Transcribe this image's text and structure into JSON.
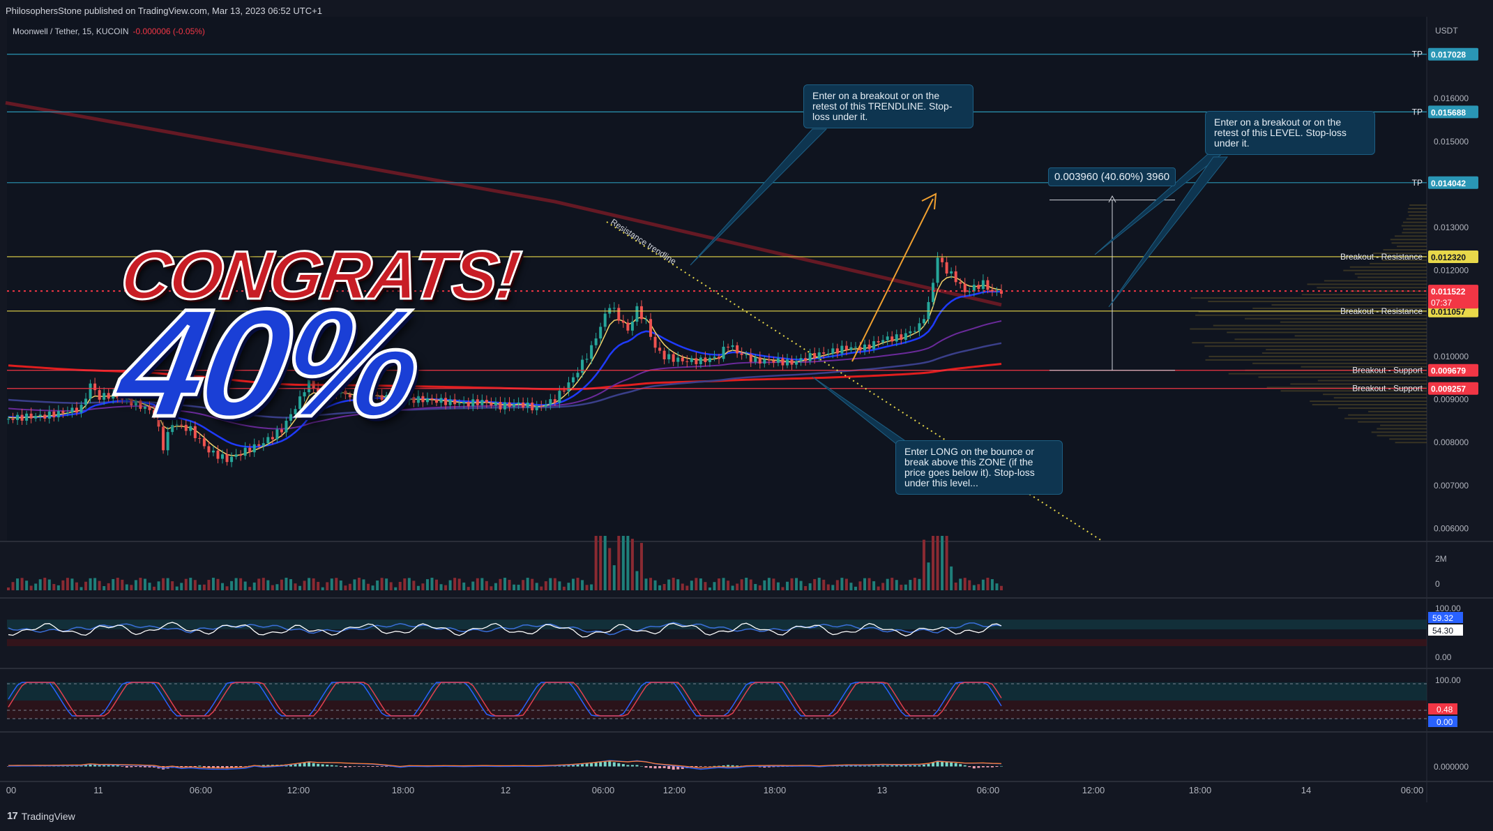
{
  "publish_line": "PhilosophersStone published on TradingView.com, Mar 13, 2023 06:52 UTC+1",
  "legend": {
    "symbol": "Moonwell / Tether, 15, KUCOIN",
    "change": "-0.000006 (-0.05%)"
  },
  "brand": "TradingView",
  "overlay": {
    "congrats": "CONGRATS!",
    "percent": "40%"
  },
  "measure_label": "0.003960 (40.60%) 3960",
  "callouts": {
    "trendline": "Enter on a breakout or on the retest of this TRENDLINE. Stop-loss under it.",
    "level": "Enter on a breakout or on the retest of this LEVEL. Stop-loss under it.",
    "zone": "Enter LONG on the bounce or break above this ZONE (if the price goes below it). Stop-loss under this level..."
  },
  "trendline_label": "Resistance trendline",
  "colors": {
    "bg": "#131722",
    "up": "#26a69a",
    "down": "#ef5350",
    "tp": "#2a96b5",
    "resistance": "#e8d84a",
    "support": "#f23645"
  },
  "chart_data": {
    "type": "candlestick",
    "quote_currency": "USDT",
    "price_axis": {
      "min": 0.0057,
      "max": 0.0179,
      "ticks": [
        "0.016000",
        "0.015000",
        "0.013000",
        "0.012000",
        "0.010000",
        "0.009000",
        "0.008000",
        "0.007000",
        "0.006000"
      ]
    },
    "time_axis": {
      "ticks": [
        "00",
        "11",
        "06:00",
        "12:00",
        "18:00",
        "12",
        "06:00",
        "12:00",
        "18:00",
        "13",
        "06:00",
        "12:00",
        "18:00",
        "14",
        "06:00"
      ]
    },
    "current_price": {
      "value": "0.011522",
      "countdown": "07:37"
    },
    "levels": [
      {
        "name": "TP",
        "value": "0.017028",
        "kind": "tp"
      },
      {
        "name": "TP",
        "value": "0.015688",
        "kind": "tp"
      },
      {
        "name": "TP",
        "value": "0.014042",
        "kind": "tp"
      },
      {
        "name": "Breakout - Resistance",
        "value": "0.012320",
        "kind": "resistance"
      },
      {
        "name": "Breakout - Resistance",
        "value": "0.011057",
        "kind": "resistance"
      },
      {
        "name": "Breakout - Support",
        "value": "0.009679",
        "kind": "support"
      },
      {
        "name": "Breakout - Support",
        "value": "0.009257",
        "kind": "support"
      }
    ],
    "price_path": [
      [
        0,
        0.00855
      ],
      [
        2,
        0.0086
      ],
      [
        4,
        0.00862
      ],
      [
        6,
        0.0087
      ],
      [
        8,
        0.0088
      ],
      [
        9,
        0.00935
      ],
      [
        10,
        0.00905
      ],
      [
        11,
        0.0091
      ],
      [
        12,
        0.00905
      ],
      [
        14,
        0.0089
      ],
      [
        16,
        0.0087
      ],
      [
        17,
        0.0079
      ],
      [
        18,
        0.00845
      ],
      [
        20,
        0.0083
      ],
      [
        22,
        0.0078
      ],
      [
        24,
        0.0076
      ],
      [
        26,
        0.0078
      ],
      [
        28,
        0.008
      ],
      [
        30,
        0.0083
      ],
      [
        32,
        0.009
      ],
      [
        33,
        0.0095
      ],
      [
        34,
        0.0091
      ],
      [
        36,
        0.0092
      ],
      [
        38,
        0.00905
      ],
      [
        40,
        0.0091
      ],
      [
        42,
        0.009
      ],
      [
        44,
        0.009
      ],
      [
        46,
        0.009
      ],
      [
        48,
        0.00895
      ],
      [
        50,
        0.0089
      ],
      [
        52,
        0.00895
      ],
      [
        54,
        0.00885
      ],
      [
        56,
        0.0089
      ],
      [
        58,
        0.0088
      ],
      [
        60,
        0.009
      ],
      [
        62,
        0.0095
      ],
      [
        64,
        0.0102
      ],
      [
        66,
        0.0112
      ],
      [
        67,
        0.0109
      ],
      [
        68,
        0.0106
      ],
      [
        69,
        0.0111
      ],
      [
        70,
        0.0108
      ],
      [
        71,
        0.0102
      ],
      [
        72,
        0.01
      ],
      [
        74,
        0.0099
      ],
      [
        76,
        0.0099
      ],
      [
        78,
        0.01
      ],
      [
        79,
        0.0103
      ],
      [
        80,
        0.0101
      ],
      [
        82,
        0.0099
      ],
      [
        84,
        0.0099
      ],
      [
        86,
        0.00985
      ],
      [
        88,
        0.01
      ],
      [
        90,
        0.0101
      ],
      [
        92,
        0.0102
      ],
      [
        94,
        0.0102
      ],
      [
        96,
        0.0104
      ],
      [
        98,
        0.01045
      ],
      [
        100,
        0.0107
      ],
      [
        101,
        0.0112
      ],
      [
        102,
        0.0123
      ],
      [
        103,
        0.012
      ],
      [
        104,
        0.0118
      ],
      [
        105,
        0.0115
      ],
      [
        106,
        0.0116
      ],
      [
        107,
        0.0117
      ],
      [
        108,
        0.0115
      ],
      [
        109,
        0.01152
      ]
    ],
    "measure": {
      "from": 0.009679,
      "to": 0.013639,
      "label": "0.003960 (40.60%) 3960"
    }
  },
  "panes": {
    "volume_ticks": [
      "2M",
      "0"
    ],
    "rsi": {
      "ticks": [
        "100.00",
        "0.00"
      ],
      "value_a": "59.32",
      "value_b": "54.30"
    },
    "stoch": {
      "ticks": [
        "100.00"
      ],
      "value_a": "0.48",
      "value_b": "0.00"
    },
    "macd": {
      "ticks": [
        "0.000000"
      ]
    }
  }
}
